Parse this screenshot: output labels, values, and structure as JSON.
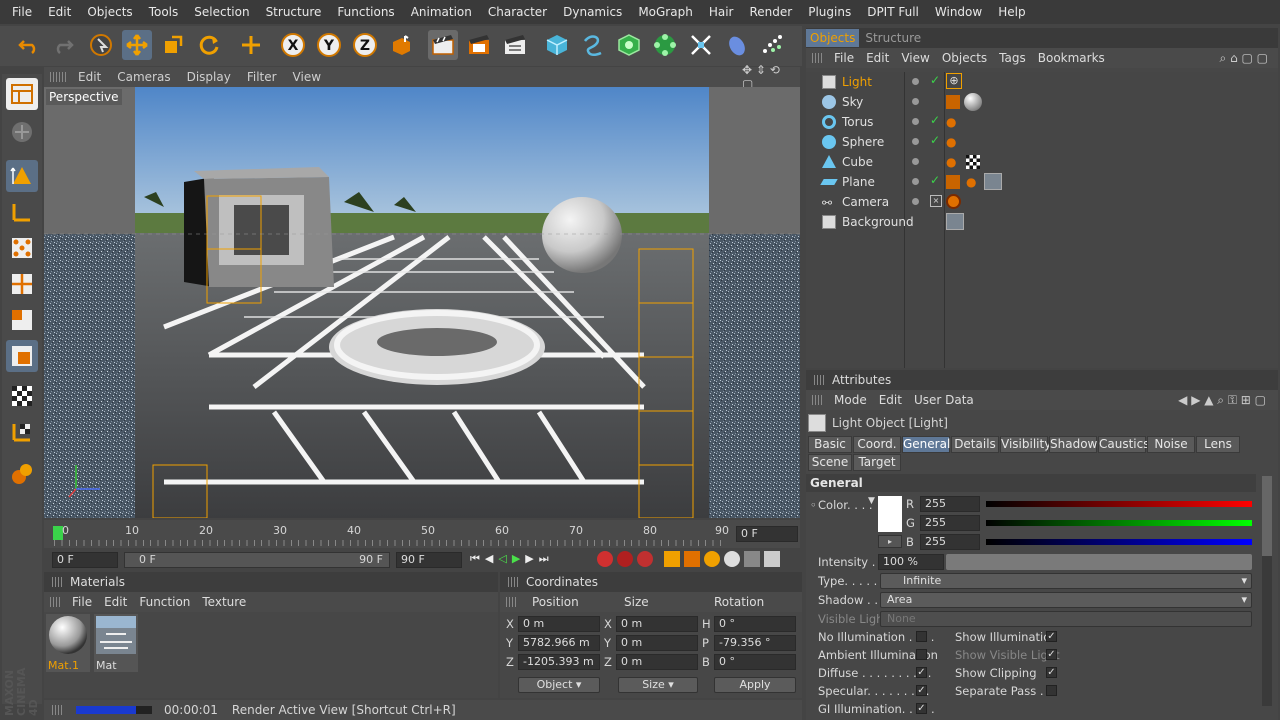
{
  "menu": [
    "File",
    "Edit",
    "Objects",
    "Tools",
    "Selection",
    "Structure",
    "Functions",
    "Animation",
    "Character",
    "Dynamics",
    "MoGraph",
    "Hair",
    "Render",
    "Plugins",
    "DPIT Full",
    "Window",
    "Help"
  ],
  "viewport": {
    "menu": [
      "Edit",
      "Cameras",
      "Display",
      "Filter",
      "View"
    ],
    "label": "Perspective"
  },
  "timeline": {
    "ticks": [
      "0",
      "10",
      "20",
      "30",
      "40",
      "50",
      "60",
      "70",
      "80",
      "90"
    ],
    "current_frame": "0 F",
    "start": "0 F",
    "range_start": "0 F",
    "range_end": "90 F",
    "end": "90 F"
  },
  "materials": {
    "title": "Materials",
    "menu": [
      "File",
      "Edit",
      "Function",
      "Texture"
    ],
    "items": [
      {
        "label": "Mat.1",
        "selected": true
      },
      {
        "label": "Mat",
        "selected": false
      }
    ]
  },
  "coordinates": {
    "title": "Coordinates",
    "headers": [
      "Position",
      "Size",
      "Rotation"
    ],
    "rows": [
      {
        "a": "X",
        "pos": "0 m",
        "b": "X",
        "size": "0 m",
        "c": "H",
        "rot": "0 °"
      },
      {
        "a": "Y",
        "pos": "5782.966 m",
        "b": "Y",
        "size": "0 m",
        "c": "P",
        "rot": "-79.356 °"
      },
      {
        "a": "Z",
        "pos": "-1205.393 m",
        "b": "Z",
        "size": "0 m",
        "c": "B",
        "rot": "0 °"
      }
    ],
    "mode": "Object",
    "size_mode": "Size",
    "apply": "Apply"
  },
  "status": {
    "time": "00:00:01",
    "message": "Render Active View [Shortcut Ctrl+R]"
  },
  "objects_panel": {
    "tabs": [
      "Objects",
      "Structure"
    ],
    "menu": [
      "File",
      "Edit",
      "View",
      "Objects",
      "Tags",
      "Bookmarks"
    ],
    "items": [
      "Light",
      "Sky",
      "Torus",
      "Sphere",
      "Cube",
      "Plane",
      "Camera",
      "Background"
    ]
  },
  "attributes": {
    "title": "Attributes",
    "menu": [
      "Mode",
      "Edit",
      "User Data"
    ],
    "object_title": "Light Object [Light]",
    "tabs_row1": [
      "Basic",
      "Coord.",
      "General",
      "Details",
      "Visibility",
      "Shadow",
      "Caustics",
      "Noise",
      "Lens"
    ],
    "tabs_row2": [
      "Scene",
      "Target"
    ],
    "active_tab": "General",
    "section": "General",
    "color_label": "Color. . . .",
    "r_label": "R",
    "g_label": "G",
    "b_label": "B",
    "r": "255",
    "g": "255",
    "b": "255",
    "intensity_label": "Intensity . . .",
    "intensity": "100 %",
    "type_label": "Type. . . . . . .",
    "type": "Infinite",
    "shadow_label": "Shadow . . . .",
    "shadow": "Area",
    "visible_light_label": "Visible Light",
    "visible_light": "None",
    "left_checks": [
      {
        "label": "No Illumination . . . .",
        "checked": false
      },
      {
        "label": "Ambient Illumination",
        "checked": false
      },
      {
        "label": "Diffuse . . . . . . . . . .",
        "checked": true
      },
      {
        "label": "Specular. . . . . . . . .",
        "checked": true
      },
      {
        "label": "GI Illumination. . . . .",
        "checked": true
      }
    ],
    "right_checks": [
      {
        "label": "Show Illumination",
        "checked": true
      },
      {
        "label": "Show Visible Light",
        "checked": true
      },
      {
        "label": "Show Clipping",
        "checked": true
      },
      {
        "label": "Separate Pass . . .",
        "checked": false
      }
    ],
    "check_glyph": "✓"
  },
  "brand": "MAXON CINEMA 4D",
  "colors": {
    "accent": "#f0a000",
    "selected_tab": "#5f7897",
    "tool_selected": "#5b6f86"
  }
}
